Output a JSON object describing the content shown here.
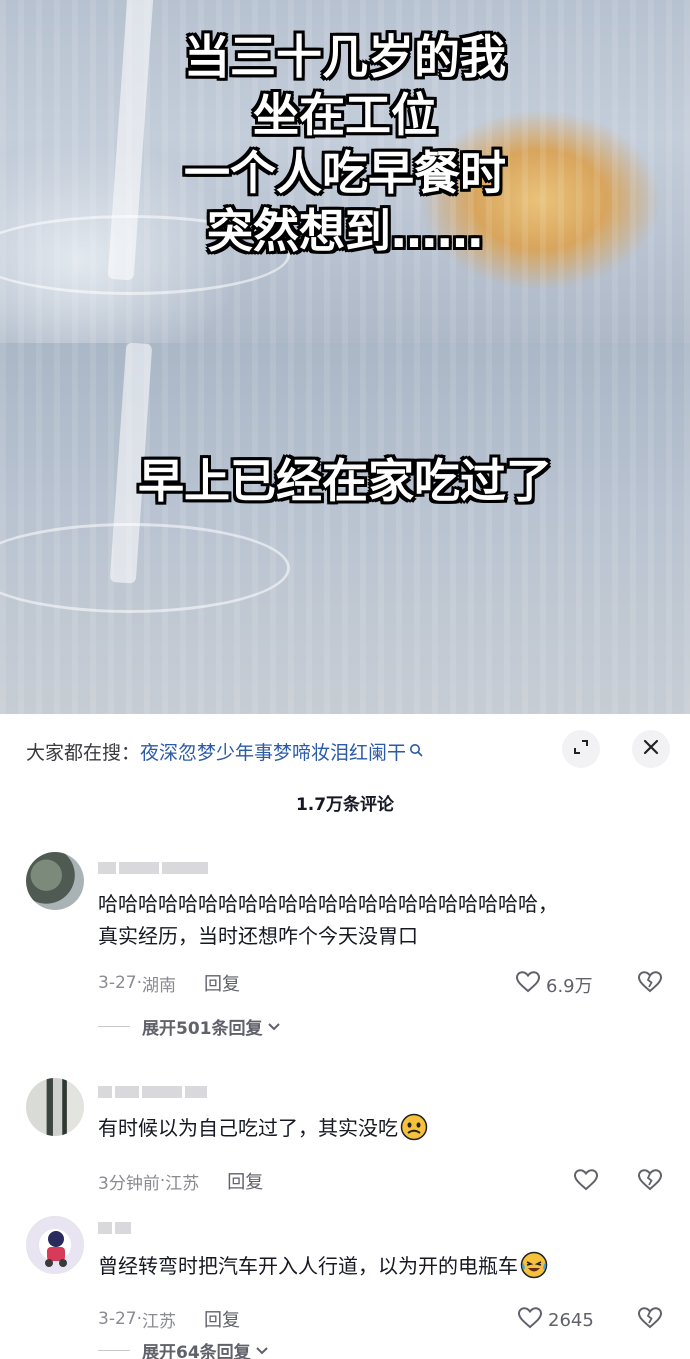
{
  "video": {
    "caption_top_lines": [
      "当三十几岁的我",
      "坐在工位",
      "一个人吃早餐时",
      "突然想到……"
    ],
    "caption_bottom": "早上已经在家吃过了"
  },
  "search": {
    "prefix": "大家都在搜：",
    "query": "夜深忽梦少年事梦啼妆泪红阑干"
  },
  "comments_header": {
    "count_label": "1.7万条评论"
  },
  "comments": [
    {
      "text_line1": "哈哈哈哈哈哈哈哈哈哈哈哈哈哈哈哈哈哈哈哈哈哈，",
      "text_line2": "真实经历，当时还想咋个今天没胃口",
      "time": "3-27",
      "location": "湖南",
      "reply_label": "回复",
      "likes": "6.9万",
      "expand_label": "展开501条回复"
    },
    {
      "text": "有时候以为自己吃过了，其实没吃",
      "emoji": "worried-face-emoji",
      "time": "3分钟前",
      "location": "江苏",
      "reply_label": "回复",
      "likes": ""
    },
    {
      "text": "曾经转弯时把汽车开入人行道，以为开的电瓶车",
      "emoji": "laughing-crying-emoji",
      "time": "3-27",
      "location": "江苏",
      "reply_label": "回复",
      "likes": "2645",
      "expand_label": "展开64条回复"
    }
  ],
  "colors": {
    "link": "#2a5aa8",
    "text": "#161823",
    "muted": "#8a8b91"
  },
  "icons": [
    "search-icon",
    "expand-icon",
    "close-icon",
    "heart-icon",
    "broken-heart-icon",
    "chevron-down-icon"
  ]
}
